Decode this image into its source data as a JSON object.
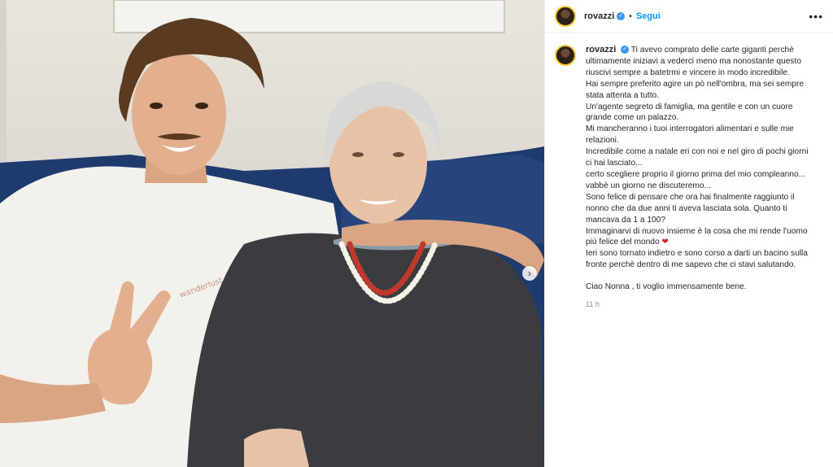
{
  "post": {
    "username": "rovazzi",
    "follow_label": "Segui",
    "separator": "•",
    "more_icon": "•••",
    "next_icon": "›",
    "verified_icon": "✓"
  },
  "caption": {
    "username": "rovazzi",
    "lines": [
      "Ti avevo comprato delle carte giganti perchè",
      "ultimamente iniziavi a vederci meno ma nonostante questo",
      "riuscivi sempre a batetrmi e vincere in modo incredibile.",
      "Hai sempre preferito agire un pò nell'ombra, ma sei sempre",
      "stata attenta a tutto.",
      "Un'agente segreto di famiglia, ma gentile e con un cuore",
      "grande come un palazzo.",
      "Mi mancheranno i tuoi interrogatori alimentari e sulle mie",
      "relazioni.",
      "Incredibile come a natale eri con noi e nel giro di pochi giorni",
      "ci hai lasciato...",
      "certo scegliere proprio il giorno prima del mio compleanno...",
      "vabbè un giorno ne discuteremo...",
      "Sono felice di pensare che ora hai finalmente raggiunto il",
      "nonno che da due anni ti aveva lasciata sola. Quanto ti",
      "mancava da 1 a 100?",
      "Immaginarvi di nuovo insieme è la cosa che mi rende l'uomo",
      "più felice del mondo",
      "Ieri sono tornato indietro e sono corso a darti un bacino sulla",
      "fronte perchè dentro di me sapevo che ci stavi salutando."
    ],
    "heart": "❤",
    "closing": "Ciao Nonna , ti voglio immensamente bene.",
    "time": "11 h"
  },
  "colors": {
    "accent_blue": "#0095f6",
    "verified_blue": "#3897f0",
    "heart_red": "#d2232a"
  },
  "photo": {
    "tshirt_print": "wanderlust"
  }
}
